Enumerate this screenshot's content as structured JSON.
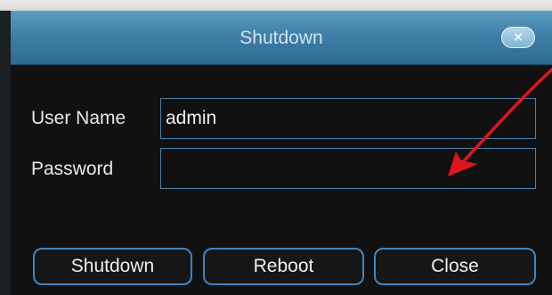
{
  "dialog": {
    "title": "Shutdown",
    "close_glyph": "✕",
    "close_icon": "close-icon"
  },
  "form": {
    "username": {
      "label": "User Name",
      "value": "admin"
    },
    "password": {
      "label": "Password",
      "value": ""
    }
  },
  "buttons": {
    "shutdown": "Shutdown",
    "reboot": "Reboot",
    "close": "Close"
  },
  "annotation": {
    "type": "red-curved-arrow",
    "color": "#e0141e"
  },
  "colors": {
    "title_bar": "#3f7fa8",
    "border_accent": "#3f85c0",
    "background": "#111111"
  }
}
